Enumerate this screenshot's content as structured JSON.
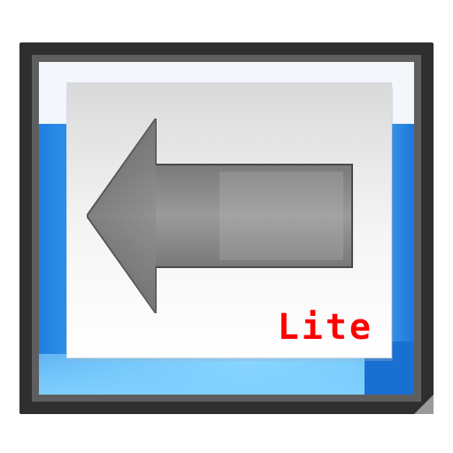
{
  "app_icon": {
    "label": "Lite",
    "icon_name": "back-arrow-icon",
    "colors": {
      "frame": "#2f2f2f",
      "frame_inner": "#5e5e5e",
      "screen_blue": "#1f7fe0",
      "screen_light_blue": "#86d2ff",
      "arrow_gray": "#7a7a7a",
      "label_red": "#ff0000"
    }
  }
}
